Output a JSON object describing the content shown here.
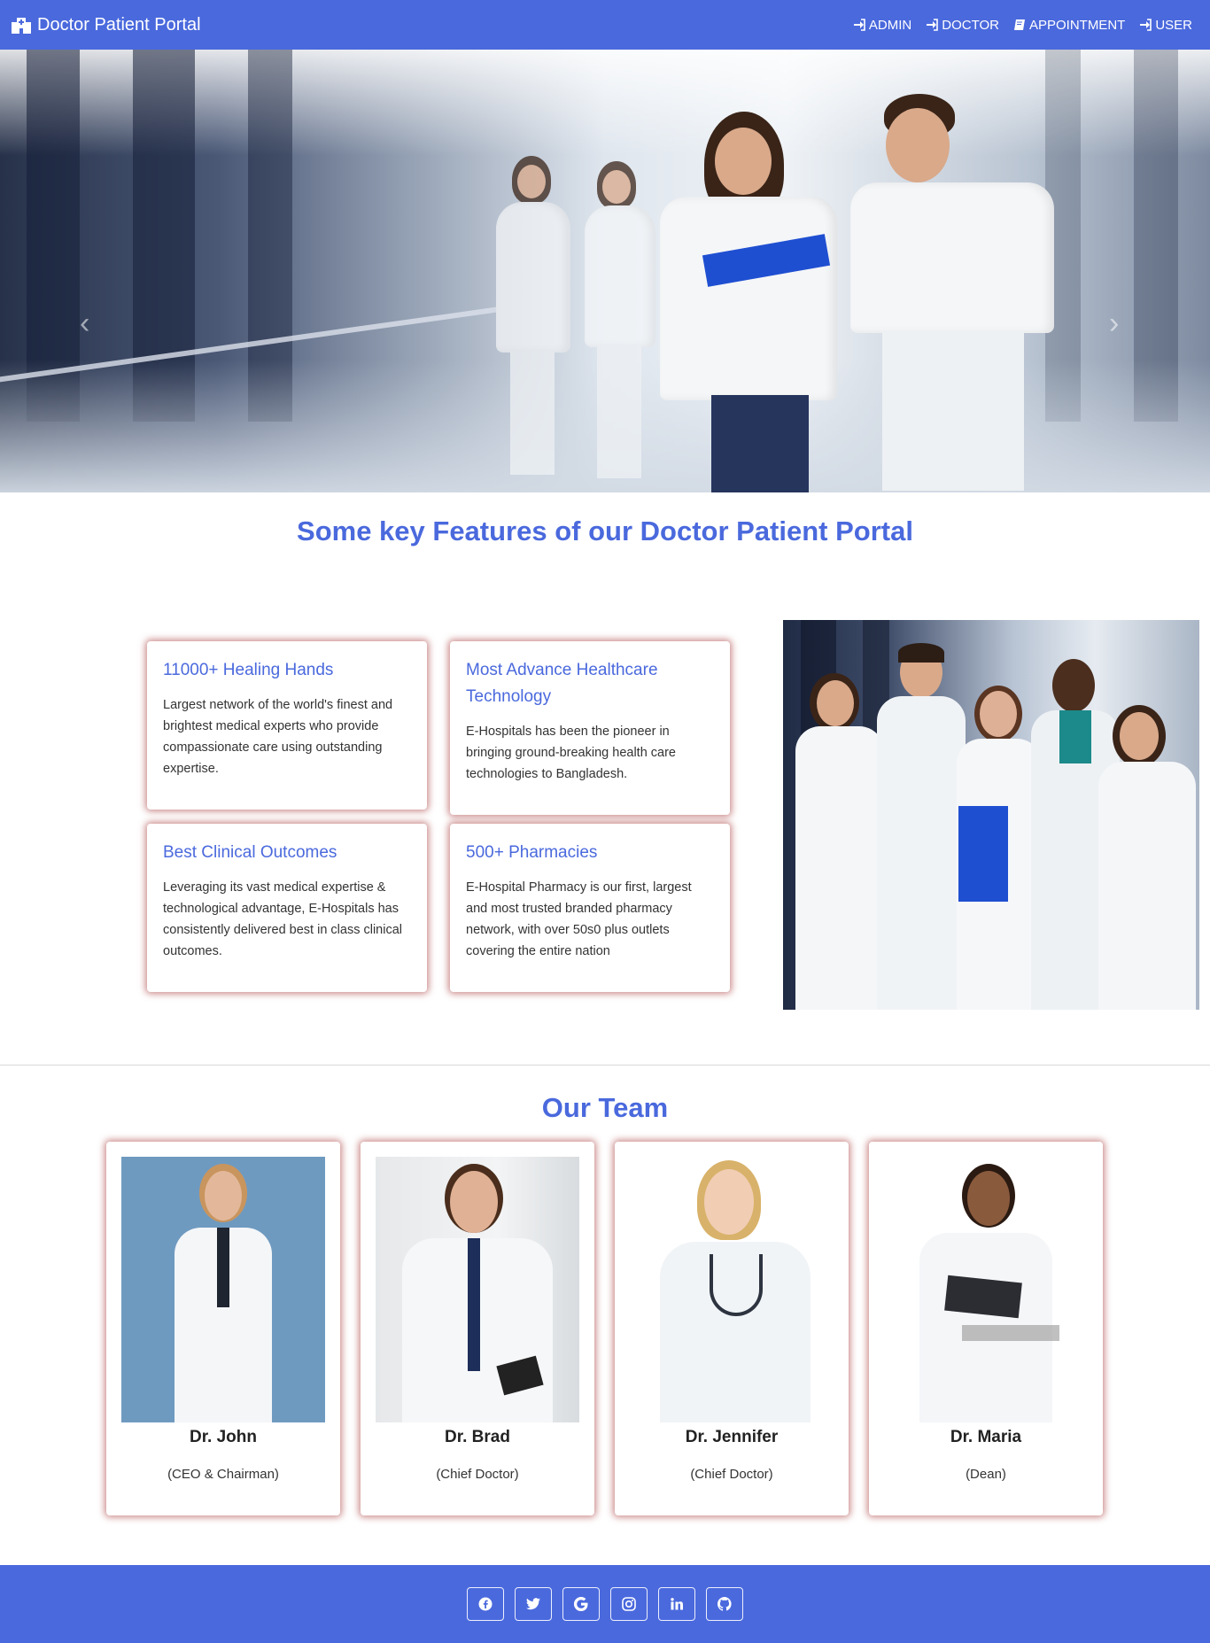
{
  "navbar": {
    "brand": "Doctor Patient Portal",
    "links": [
      {
        "label": "ADMIN",
        "icon": "sign-in-icon"
      },
      {
        "label": "DOCTOR",
        "icon": "sign-in-icon"
      },
      {
        "label": "APPOINTMENT",
        "icon": "book-icon"
      },
      {
        "label": "USER",
        "icon": "sign-in-icon"
      }
    ]
  },
  "carousel": {
    "slide_count": 4,
    "active_slide": 1
  },
  "features": {
    "title": "Some key Features of our Doctor Patient Portal",
    "cards": [
      {
        "title": "11000+ Healing Hands",
        "text": "Largest network of the world's finest and brightest medical experts who provide compassionate care using outstanding expertise."
      },
      {
        "title": "Most Advance Healthcare Technology",
        "text": "E-Hospitals has been the pioneer in bringing ground-breaking health care technologies to Bangladesh."
      },
      {
        "title": "Best Clinical Outcomes",
        "text": "Leveraging its vast medical expertise & technological advantage, E-Hospitals has consistently delivered best in class clinical outcomes."
      },
      {
        "title": "500+ Pharmacies",
        "text": "E-Hospital Pharmacy is our first, largest and most trusted branded pharmacy network, with over 50s0 plus outlets covering the entire nation"
      }
    ]
  },
  "team": {
    "title": "Our Team",
    "members": [
      {
        "name": "Dr. John",
        "role": "(CEO & Chairman)"
      },
      {
        "name": "Dr. Brad",
        "role": "(Chief Doctor)"
      },
      {
        "name": "Dr. Jennifer",
        "role": "(Chief Doctor)"
      },
      {
        "name": "Dr. Maria",
        "role": "(Dean)"
      }
    ]
  },
  "footer": {
    "social": [
      "facebook-icon",
      "twitter-icon",
      "google-icon",
      "instagram-icon",
      "linkedin-icon",
      "github-icon"
    ]
  },
  "colors": {
    "primary": "#4a69dd",
    "card_shadow": "#a02828"
  }
}
